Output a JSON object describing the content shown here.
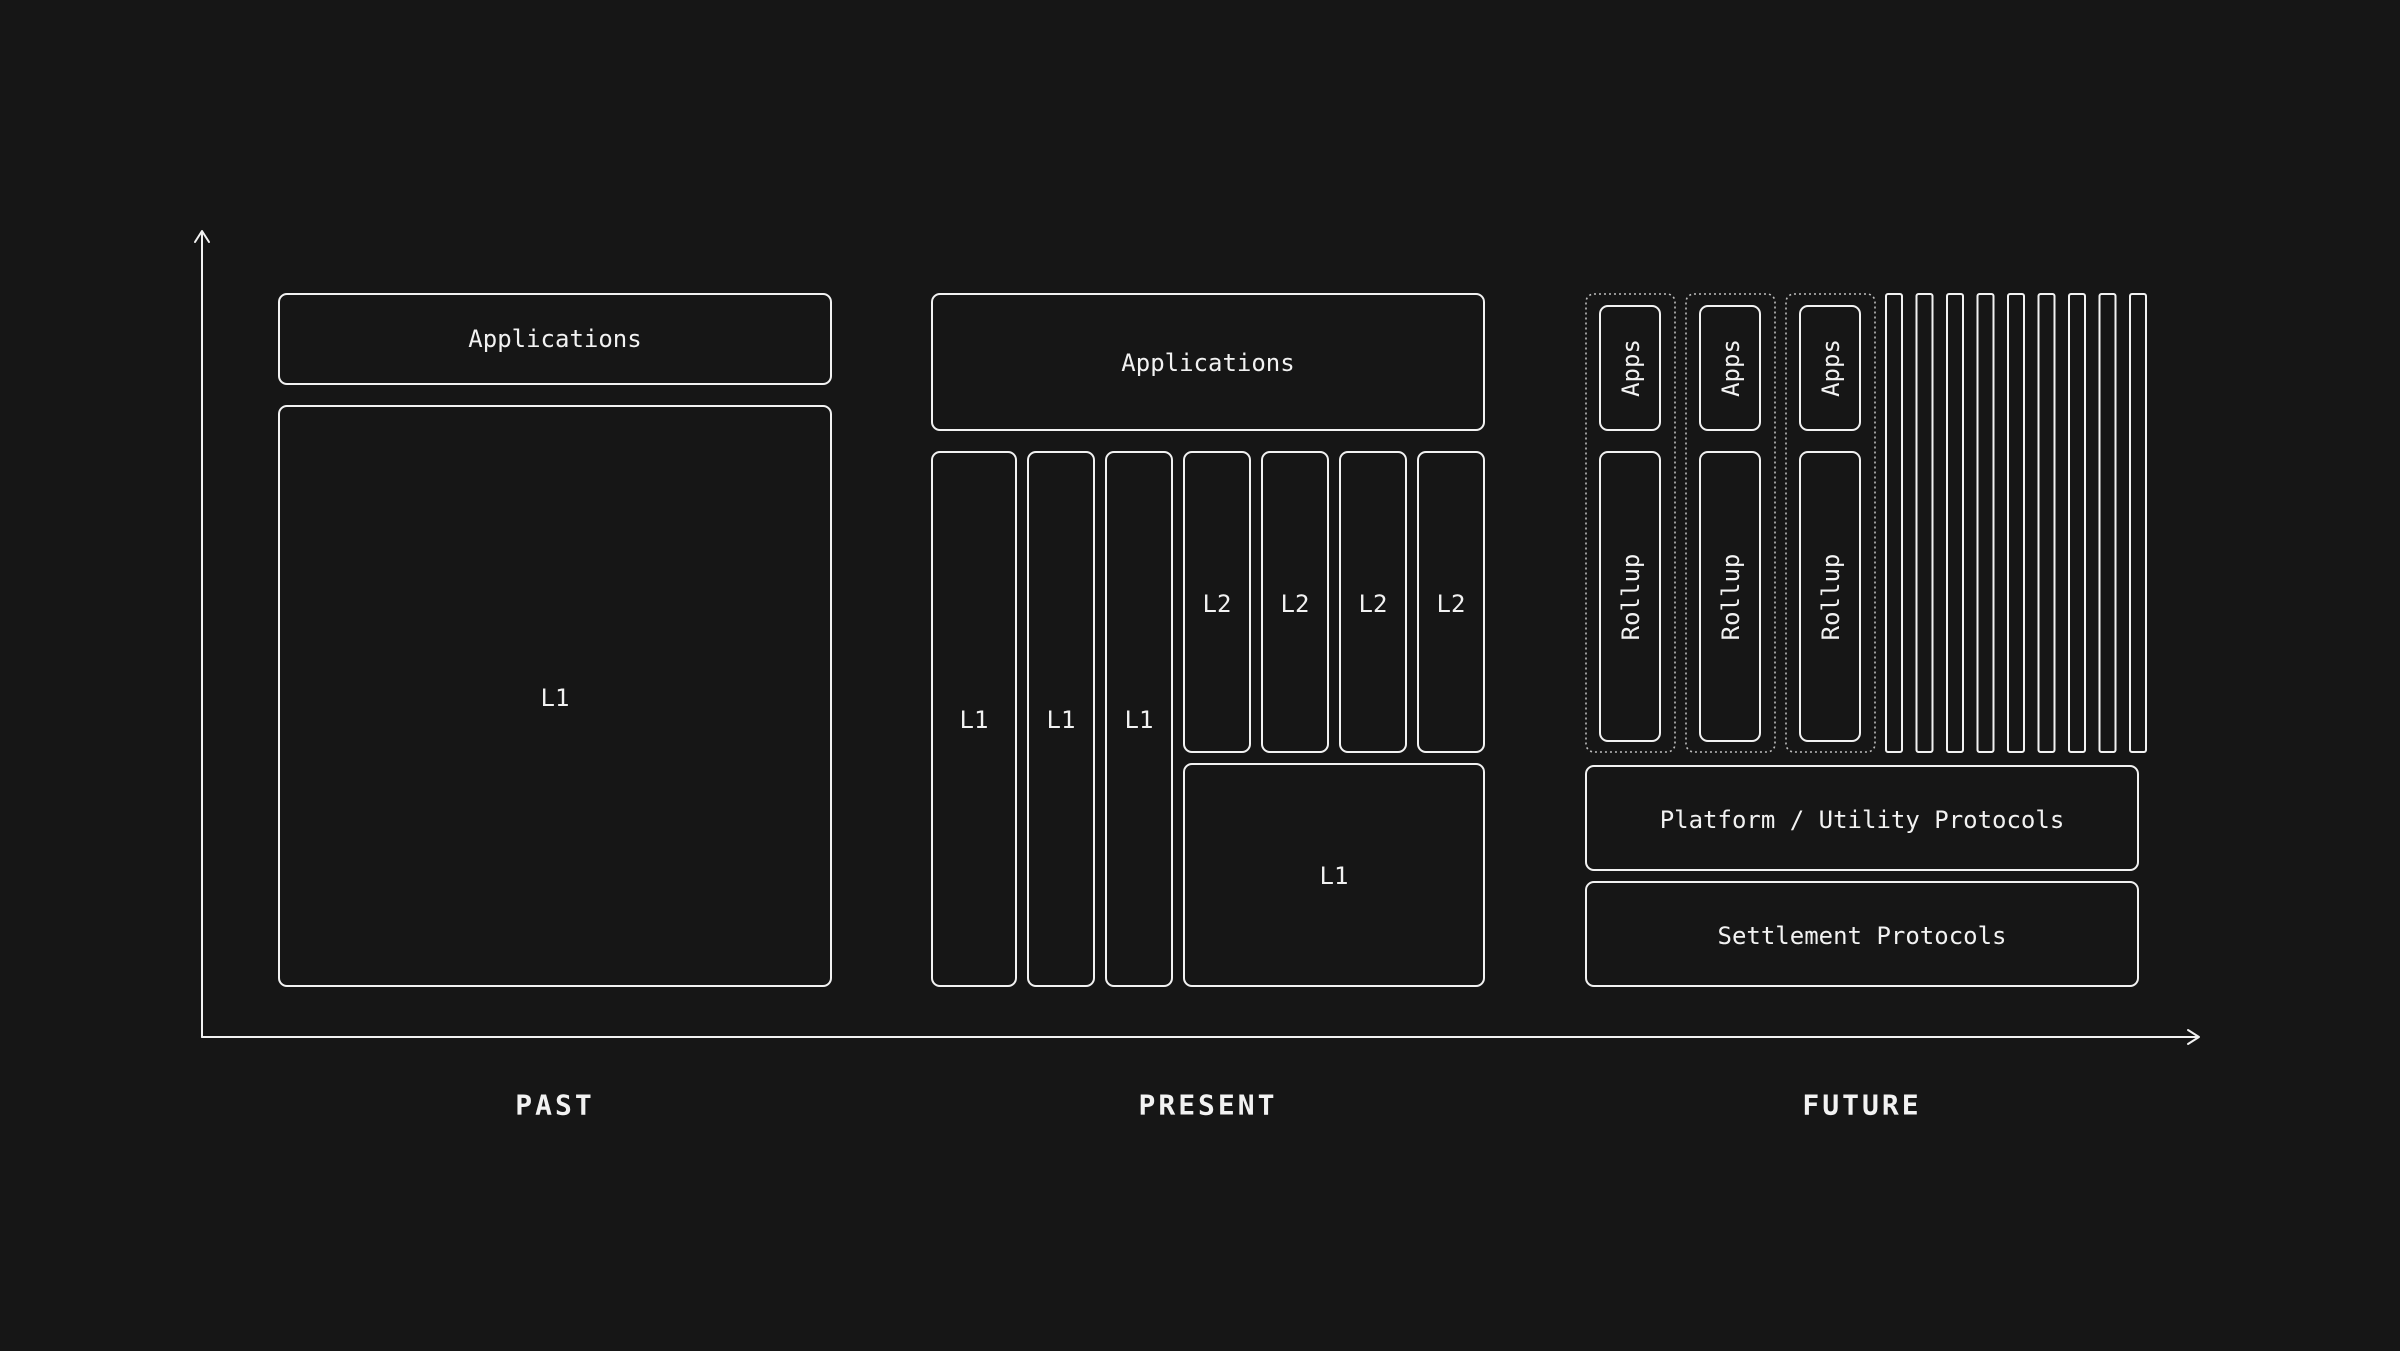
{
  "colors": {
    "background": "#161616",
    "stroke": "#f2f2f2",
    "dotted_stroke": "#bdbdbd"
  },
  "eras": {
    "past": "PAST",
    "present": "PRESENT",
    "future": "FUTURE"
  },
  "past": {
    "applications": "Applications",
    "l1": "L1"
  },
  "present": {
    "applications": "Applications",
    "l1_columns": [
      "L1",
      "L1",
      "L1"
    ],
    "l2_columns": [
      "L2",
      "L2",
      "L2",
      "L2"
    ],
    "shared_l1": "L1"
  },
  "future": {
    "rollup_groups": [
      {
        "apps": "Apps",
        "rollup": "Rollup"
      },
      {
        "apps": "Apps",
        "rollup": "Rollup"
      },
      {
        "apps": "Apps",
        "rollup": "Rollup"
      }
    ],
    "extra_rollup_count": 9,
    "platform": "Platform / Utility Protocols",
    "settlement": "Settlement Protocols"
  }
}
